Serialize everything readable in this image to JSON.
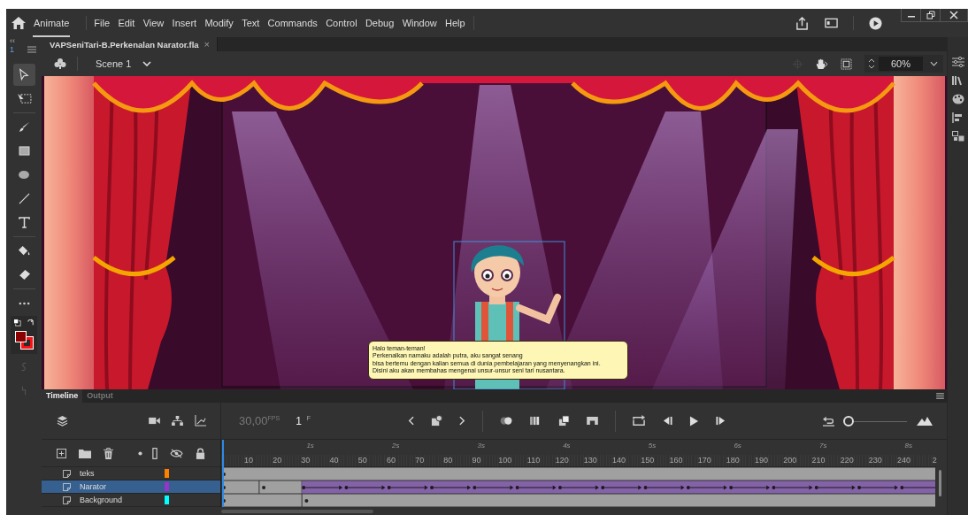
{
  "app": {
    "name": "Animate"
  },
  "menu": [
    "File",
    "Edit",
    "View",
    "Insert",
    "Modify",
    "Text",
    "Commands",
    "Control",
    "Debug",
    "Window",
    "Help"
  ],
  "panel_header": {
    "collapse": "‹‹",
    "number": "1"
  },
  "document_tab": {
    "title": "VAPSeniTari-B.Perkenalan Narator.fla",
    "close": "×"
  },
  "scene": {
    "name": "Scene 1"
  },
  "zoom": {
    "value": "60%"
  },
  "tools": [
    {
      "kind": "select",
      "selected": true
    },
    {
      "kind": "transform",
      "selected": false
    },
    {
      "kind": "brush",
      "selected": false
    },
    {
      "kind": "rectangle",
      "selected": false
    },
    {
      "kind": "oval",
      "selected": false
    },
    {
      "kind": "line",
      "selected": false
    },
    {
      "kind": "text",
      "selected": false
    },
    {
      "kind": "bucket",
      "selected": false
    },
    {
      "kind": "eraser",
      "selected": false
    },
    {
      "kind": "more",
      "selected": false
    }
  ],
  "swatches": [
    {
      "kind": "stroke",
      "color": "#ff1010"
    },
    {
      "kind": "fill",
      "color": "#8b0000"
    }
  ],
  "speech_bubble": [
    "Halo teman-teman!",
    "Perkenalkan namaku adalah putra, aku sangat senang",
    "bisa bertemu dengan kalian semua di dunia pembelajaran yang menyenangkan ini.",
    "Disini aku akan membahas mengenai unsur-unsur seni tari nusantara."
  ],
  "timeline": {
    "tabs": [
      {
        "label": "Timeline",
        "selected": true
      },
      {
        "label": "Output",
        "selected": false
      }
    ],
    "fps": "30,00",
    "fps_unit": "FPS",
    "frame": "1",
    "frame_unit": "F",
    "zoom_slider": {
      "level": 0
    },
    "seconds": [
      "1s",
      "2s",
      "3s",
      "4s",
      "5s",
      "6s",
      "7s",
      "8s"
    ],
    "frame_numbers": [
      "10",
      "20",
      "30",
      "40",
      "50",
      "60",
      "70",
      "80",
      "90",
      "100",
      "110",
      "120",
      "130",
      "140",
      "150",
      "160",
      "170",
      "180",
      "190",
      "200",
      "210",
      "220",
      "230",
      "240",
      "2"
    ],
    "layers": [
      {
        "name": "teks",
        "color": "#ff8000",
        "selected": false,
        "kind": "static"
      },
      {
        "name": "Narator",
        "color": "#9933cc",
        "selected": true,
        "kind": "tween"
      },
      {
        "name": "Background",
        "color": "#00ffff",
        "selected": false,
        "kind": "held"
      }
    ]
  }
}
